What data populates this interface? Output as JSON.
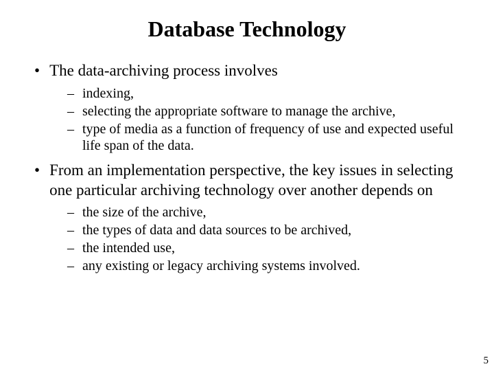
{
  "title": "Database Technology",
  "bullets": [
    {
      "text": "The data-archiving process involves",
      "sub": [
        "indexing,",
        "selecting the appropriate software to manage the archive,",
        "type of media as a function of frequency of use and expected useful life span of the data."
      ]
    },
    {
      "text": "From an implementation perspective, the key issues in selecting one particular archiving technology over another depends on",
      "sub": [
        "the size of the archive,",
        "the types of data and data sources to be archived,",
        "the intended use,",
        "any existing or legacy archiving systems involved."
      ]
    }
  ],
  "page_number": "5"
}
